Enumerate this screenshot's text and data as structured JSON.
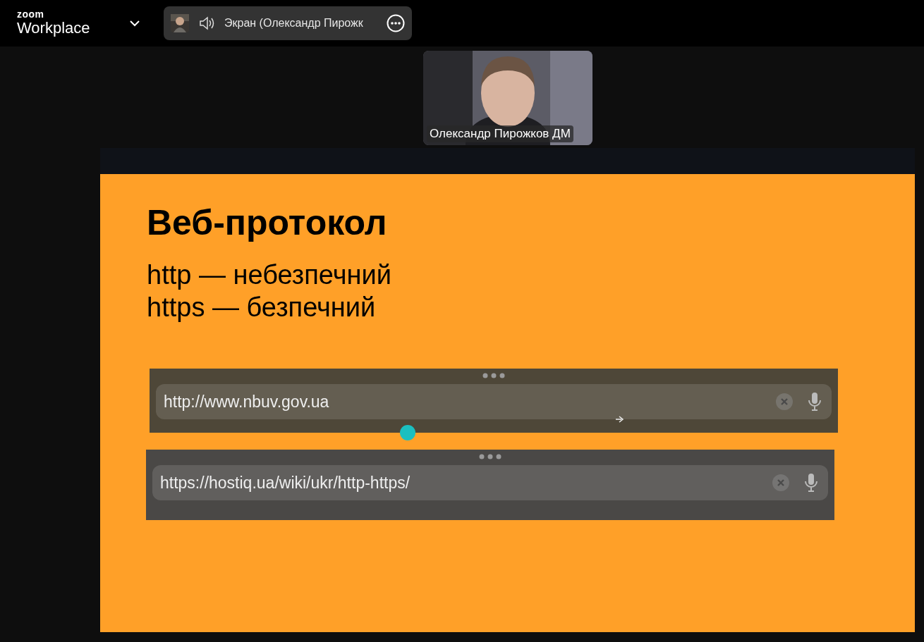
{
  "app": {
    "brand": "zoom",
    "product": "Workplace"
  },
  "share_pill": {
    "label": "Экран (Олександр Пирожк"
  },
  "video": {
    "name": "Олександр Пирожков ДМ"
  },
  "slide": {
    "title": "Веб-протокол",
    "lines": [
      "http — небезпечний",
      "https — безпечний"
    ],
    "url_bars": [
      {
        "url": "http://www.nbuv.gov.ua"
      },
      {
        "url": "https://hostiq.ua/wiki/ukr/http-https/"
      }
    ]
  }
}
